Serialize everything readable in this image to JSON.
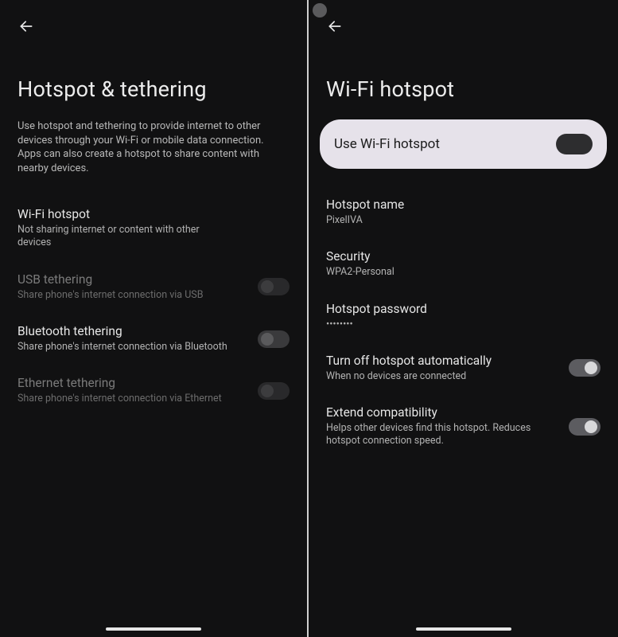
{
  "left": {
    "title": "Hotspot & tethering",
    "intro": "Use hotspot and tethering to provide internet to other devices through your Wi-Fi or mobile data connection. Apps can also create a hotspot to share content with nearby devices.",
    "items": [
      {
        "label": "Wi-Fi hotspot",
        "sub": "Not sharing internet or content with other devices",
        "disabled": false,
        "toggle": null
      },
      {
        "label": "USB tethering",
        "sub": "Share phone's internet connection via USB",
        "disabled": true,
        "toggle": false
      },
      {
        "label": "Bluetooth tethering",
        "sub": "Share phone's internet connection via Bluetooth",
        "disabled": false,
        "toggle": false
      },
      {
        "label": "Ethernet tethering",
        "sub": "Share phone's internet connection via Ethernet",
        "disabled": true,
        "toggle": false
      }
    ]
  },
  "right": {
    "title": "Wi-Fi hotspot",
    "card": {
      "label": "Use Wi-Fi hotspot",
      "toggle": false
    },
    "items": [
      {
        "label": "Hotspot name",
        "sub": "PixelIVA",
        "toggle": null
      },
      {
        "label": "Security",
        "sub": "WPA2-Personal",
        "toggle": null
      },
      {
        "label": "Hotspot password",
        "sub": "••••••••",
        "toggle": null
      },
      {
        "label": "Turn off hotspot automatically",
        "sub": "When no devices are connected",
        "toggle": true
      },
      {
        "label": "Extend compatibility",
        "sub": "Helps other devices find this hotspot. Reduces hotspot connection speed.",
        "toggle": true
      }
    ]
  }
}
